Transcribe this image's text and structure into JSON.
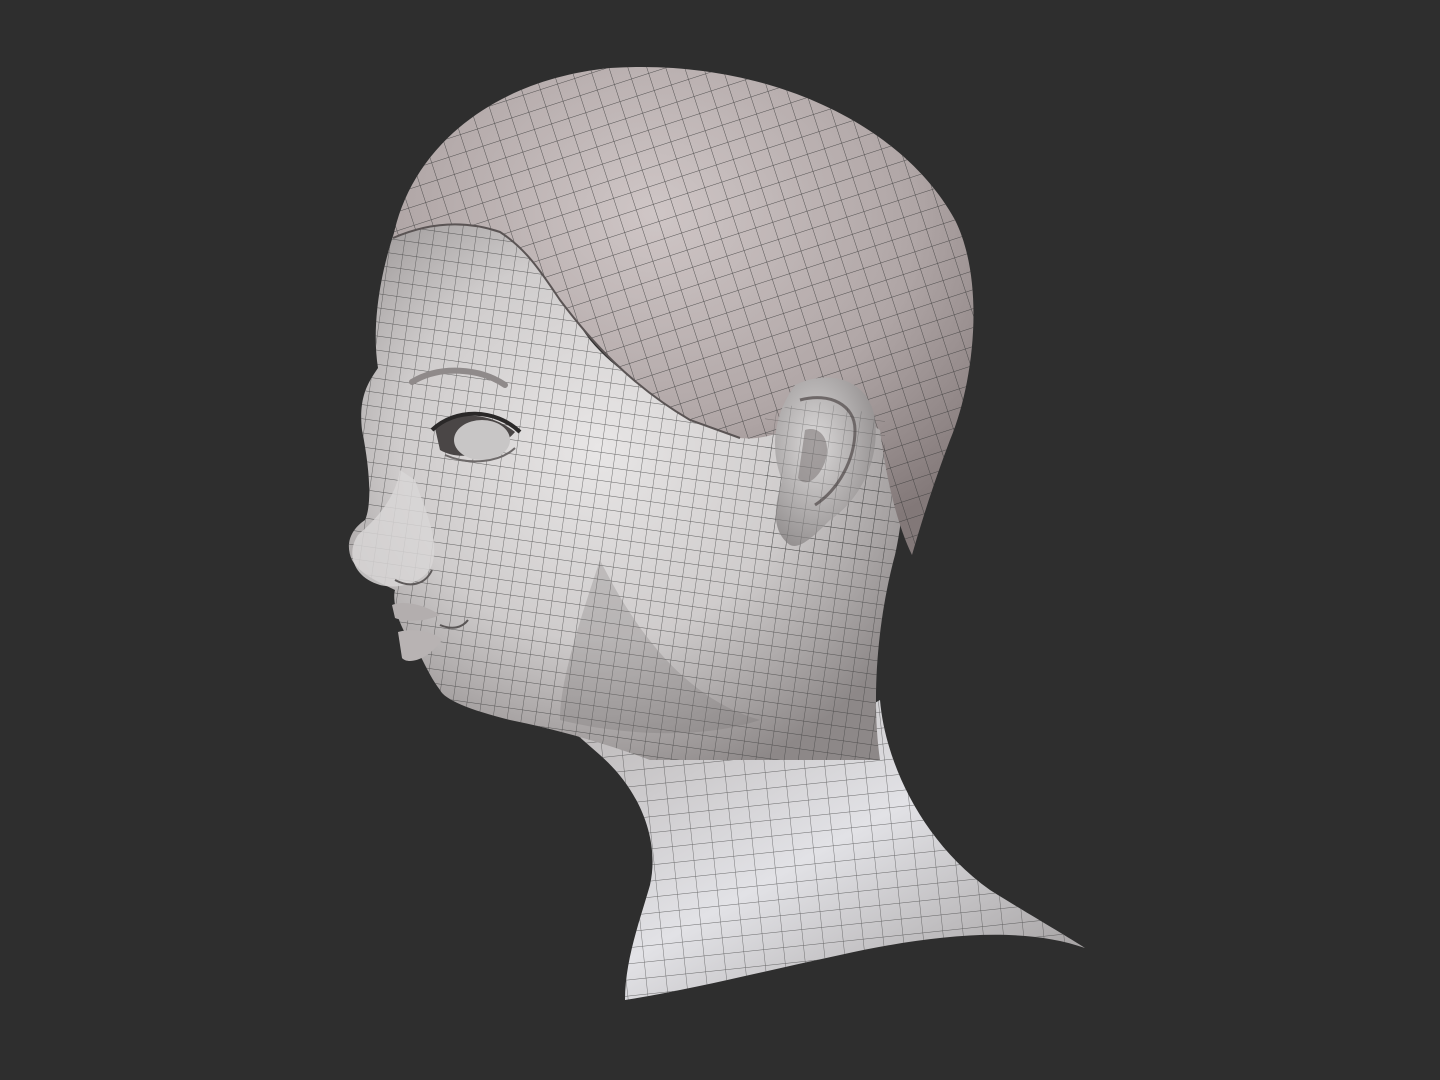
{
  "scene": {
    "background_color": "#2e2e2e",
    "subject": "sculpted-head-wireframe",
    "mesh_base_color": "#d4d2d2",
    "mesh_shadow_color": "#8f8a8a",
    "hair_cap_color": "#b8aeae",
    "wire_color": "#3a3a3a",
    "view": "left-profile"
  }
}
